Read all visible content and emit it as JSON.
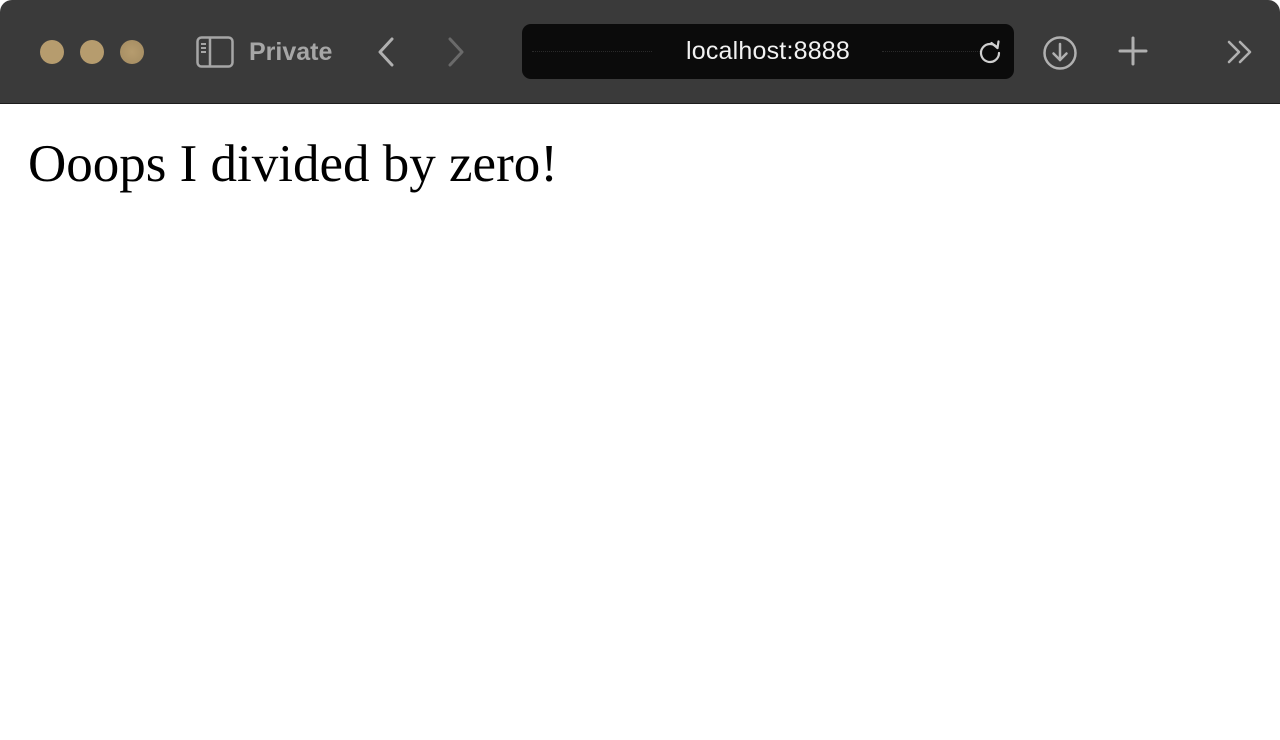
{
  "toolbar": {
    "traffic_lights": [
      "close",
      "minimize",
      "zoom"
    ],
    "traffic_light_color": "#b69c6e",
    "sidebar_icon": "sidebar-icon",
    "private_label": "Private",
    "back_icon": "chevron-left-icon",
    "forward_icon": "chevron-right-icon",
    "address": "localhost:8888",
    "reload_icon": "reload-icon",
    "downloads_icon": "download-icon",
    "new_tab_icon": "plus-icon",
    "overflow_icon": "double-chevron-right-icon",
    "background_color": "#3a3a3a",
    "address_background": "#0b0b0b"
  },
  "page": {
    "message": "Ooops I divided by zero!"
  }
}
